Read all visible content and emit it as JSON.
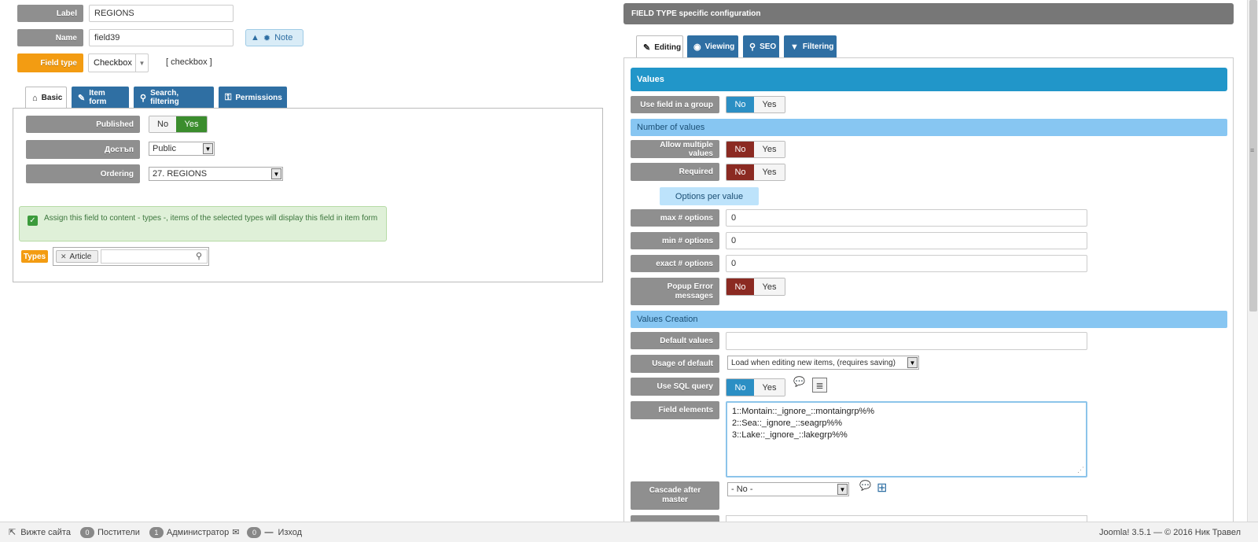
{
  "left": {
    "label_field": {
      "label": "Label",
      "value": "REGIONS"
    },
    "name_field": {
      "label": "Name",
      "value": "field39",
      "note_label": "Note"
    },
    "field_type": {
      "label": "Field type",
      "value": "Checkbox",
      "code": "[ checkbox ]"
    },
    "tabs": [
      {
        "label": "Basic",
        "icon": "home-icon"
      },
      {
        "label": "Item form",
        "icon": "edit-icon"
      },
      {
        "label": "Search, filtering",
        "icon": "search-icon"
      },
      {
        "label": "Permissions",
        "icon": "key-icon"
      }
    ],
    "published": {
      "label": "Published",
      "no": "No",
      "yes": "Yes"
    },
    "access": {
      "label": "Достъп",
      "value": "Public"
    },
    "ordering": {
      "label": "Ordering",
      "value": "27. REGIONS"
    },
    "assign_notice": "Assign this field to content - types -, items of the selected types will display this field in item form",
    "types": {
      "label": "Types",
      "chip": "Article"
    }
  },
  "right": {
    "header": "FIELD TYPE specific configuration",
    "tabs": [
      {
        "label": "Editing",
        "icon": "edit-icon"
      },
      {
        "label": "Viewing",
        "icon": "eye-icon"
      },
      {
        "label": "SEO",
        "icon": "search-icon"
      },
      {
        "label": "Filtering",
        "icon": "filter-icon"
      }
    ],
    "values_header": "Values",
    "use_in_group": {
      "label": "Use field in a group",
      "no": "No",
      "yes": "Yes"
    },
    "number_of_values_header": "Number of values",
    "allow_multiple": {
      "label": "Allow multiple values",
      "no": "No",
      "yes": "Yes"
    },
    "required": {
      "label": "Required",
      "no": "No",
      "yes": "Yes"
    },
    "options_per_value": "Options per value",
    "max_options": {
      "label": "max # options",
      "value": "0"
    },
    "min_options": {
      "label": "min # options",
      "value": "0"
    },
    "exact_options": {
      "label": "exact # options",
      "value": "0"
    },
    "popup_error": {
      "label_line1": "Popup Error",
      "label_line2": "messages",
      "no": "No",
      "yes": "Yes"
    },
    "values_creation_header": "Values Creation",
    "default_values": {
      "label": "Default values",
      "value": ""
    },
    "usage_of_default": {
      "label": "Usage of default",
      "value": "Load when editing new items, (requires saving)"
    },
    "use_sql": {
      "label": "Use SQL query",
      "no": "No",
      "yes": "Yes"
    },
    "field_elements": {
      "label": "Field elements",
      "lines": [
        "1::Montain::_ignore_::montaingrp%%",
        "2::Sea::_ignore_::seagrp%%",
        "3::Lake::_ignore_::lakegrp%%"
      ]
    },
    "cascade": {
      "label_line1": "Cascade after",
      "label_line2": "master",
      "value": "- No -"
    }
  },
  "footer": {
    "view_site": "Вижте сайта",
    "visitors_count": "0",
    "visitors": "Постители",
    "admins_count": "1",
    "admins": "Администратор",
    "messages_count": "0",
    "logout": "Изход",
    "version": "Joomla! 3.5.1 — © 2016 Ник Травел"
  },
  "colors": {
    "label_gray": "#8f8f8f",
    "orange": "#f39c12",
    "blue_tab": "#2f6fa3",
    "values_bar": "#2196c9",
    "light_bar": "#87c6f2",
    "no_red": "#8b2a22",
    "no_blue": "#2b8fc4",
    "yes_green": "#3b8d2d"
  }
}
